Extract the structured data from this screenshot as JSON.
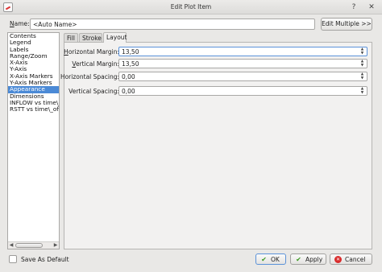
{
  "window": {
    "title": "Edit Plot Item",
    "help_glyph": "?",
    "close_glyph": "✕"
  },
  "name": {
    "label_underlined": "N",
    "label_rest": "ame:",
    "value": "<Auto Name>"
  },
  "edit_multiple_label": "Edit Multiple >>",
  "sidebar": {
    "items": [
      {
        "label": "Contents"
      },
      {
        "label": "Legend"
      },
      {
        "label": "Labels"
      },
      {
        "label": "Range/Zoom"
      },
      {
        "label": "X-Axis"
      },
      {
        "label": "Y-Axis"
      },
      {
        "label": "X-Axis Markers"
      },
      {
        "label": "Y-Axis Markers"
      },
      {
        "label": "Appearance"
      },
      {
        "label": "Dimensions"
      },
      {
        "label": "INFLOW vs time\\_o"
      },
      {
        "label": "RSTT vs time\\_offs"
      }
    ],
    "selected_index": 8
  },
  "tabs": [
    {
      "label": "Fill"
    },
    {
      "label": "Stroke"
    },
    {
      "label": "Layout"
    }
  ],
  "active_tab": "Layout",
  "layout": {
    "fields": [
      {
        "label_underlined": "H",
        "label_rest": "orizontal Margin:",
        "value": "13,50"
      },
      {
        "label_underlined": "V",
        "label_rest": "ertical Margin:",
        "value": "13,50"
      },
      {
        "label_underlined": "",
        "label_rest": "Horizontal Spacing:",
        "value": "0,00"
      },
      {
        "label_underlined": "",
        "label_rest": "Vertical Spacing:",
        "value": "0,00"
      }
    ]
  },
  "footer": {
    "save_as_default": "Save As Default",
    "save_as_default_checked": false,
    "ok_label": "OK",
    "apply_label": "Apply",
    "cancel_label": "Cancel"
  },
  "icons": {
    "ok": "check-icon",
    "apply": "check-icon",
    "cancel": "cancel-icon",
    "spin": "spin-arrows-icon"
  },
  "colors": {
    "selection": "#4b8ad6",
    "focus": "#5b92d9",
    "ok_green": "#3a9a1f",
    "cancel_red": "#d92c2c"
  }
}
